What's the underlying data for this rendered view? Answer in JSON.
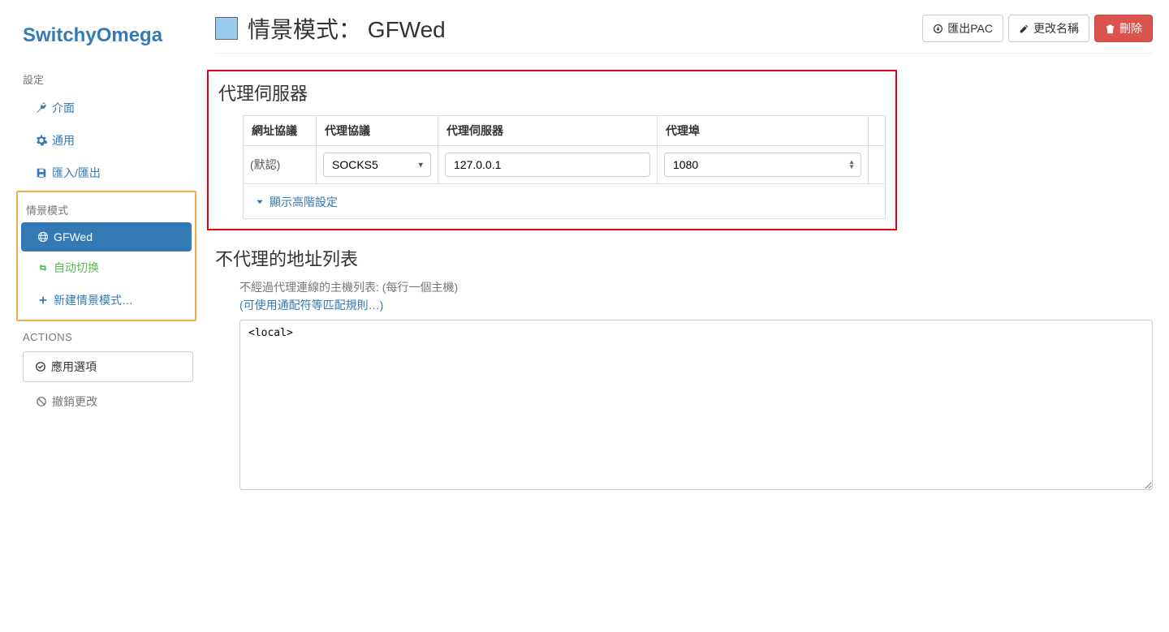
{
  "brand": "SwitchyOmega",
  "sidebar": {
    "settings_header": "設定",
    "interface": "介面",
    "general": "通用",
    "import_export": "匯入/匯出",
    "profiles_header": "情景模式",
    "profile_gfwed": "GFWed",
    "profile_auto": "自动切换",
    "new_profile": "新建情景模式…",
    "actions_header": "ACTIONS",
    "apply": "應用選項",
    "discard": "撤銷更改"
  },
  "header": {
    "title_prefix": "情景模式：",
    "profile_name": "GFWed",
    "export_pac": "匯出PAC",
    "rename": "更改名稱",
    "delete": "刪除"
  },
  "proxy": {
    "section_title": "代理伺服器",
    "th_scheme": "網址協議",
    "th_protocol": "代理協議",
    "th_server": "代理伺服器",
    "th_port": "代理埠",
    "default_label": "(默認)",
    "protocol_value": "SOCKS5",
    "server_value": "127.0.0.1",
    "port_value": "1080",
    "advanced": "顯示高階設定"
  },
  "bypass": {
    "section_title": "不代理的地址列表",
    "desc": "不經過代理連線的主機列表: (每行一個主機)",
    "help_link": "(可使用通配符等匹配規則…)",
    "content": "<local>"
  }
}
